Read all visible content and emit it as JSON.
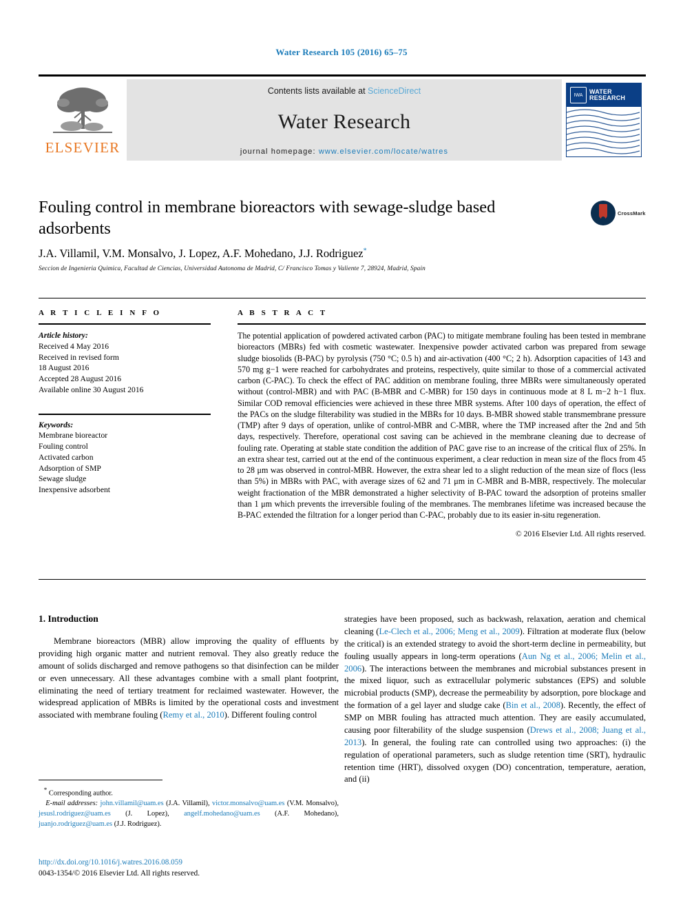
{
  "running_head": "Water Research 105 (2016) 65–75",
  "masthead": {
    "publisher_logo_text": "ELSEVIER",
    "contents_prefix": "Contents lists available at",
    "contents_link": "ScienceDirect",
    "journal_name": "Water Research",
    "homepage_prefix": "journal homepage:",
    "homepage_url": "www.elsevier.com/locate/watres",
    "cover_badge": "IWA",
    "cover_title_line1": "WATER",
    "cover_title_line2": "RESEARCH"
  },
  "article": {
    "title": "Fouling control in membrane bioreactors with sewage-sludge based adsorbents",
    "crossmark_label": "CrossMark",
    "authors": "J.A. Villamil, V.M. Monsalvo, J. Lopez, A.F. Mohedano, J.J. Rodriguez",
    "corresponding_marker": "*",
    "affiliation": "Seccion de Ingenieria Quimica, Facultad de Ciencias, Universidad Autonoma de Madrid, C/ Francisco Tomas y Valiente 7, 28924, Madrid, Spain"
  },
  "article_info": {
    "heading": "A R T I C L E   I N F O",
    "history_label": "Article history:",
    "history": [
      "Received 4 May 2016",
      "Received in revised form",
      "18 August 2016",
      "Accepted 28 August 2016",
      "Available online 30 August 2016"
    ],
    "keywords_label": "Keywords:",
    "keywords": [
      "Membrane bioreactor",
      "Fouling control",
      "Activated carbon",
      "Adsorption of SMP",
      "Sewage sludge",
      "Inexpensive adsorbent"
    ]
  },
  "abstract": {
    "heading": "A B S T R A C T",
    "text": "The potential application of powdered activated carbon (PAC) to mitigate membrane fouling has been tested in membrane bioreactors (MBRs) fed with cosmetic wastewater. Inexpensive powder activated carbon was prepared from sewage sludge biosolids (B-PAC) by pyrolysis (750 °C; 0.5 h) and air-activation (400 °C; 2 h). Adsorption capacities of 143 and 570 mg g−1 were reached for carbohydrates and proteins, respectively, quite similar to those of a commercial activated carbon (C-PAC). To check the effect of PAC addition on membrane fouling, three MBRs were simultaneously operated without (control-MBR) and with PAC (B-MBR and C-MBR) for 150 days in continuous mode at 8 L m−2 h−1 flux. Similar COD removal efficiencies were achieved in these three MBR systems. After 100 days of operation, the effect of the PACs on the sludge filterability was studied in the MBRs for 10 days. B-MBR showed stable transmembrane pressure (TMP) after 9 days of operation, unlike of control-MBR and C-MBR, where the TMP increased after the 2nd and 5th days, respectively. Therefore, operational cost saving can be achieved in the membrane cleaning due to decrease of fouling rate. Operating at stable state condition the addition of PAC gave rise to an increase of the critical flux of 25%. In an extra shear test, carried out at the end of the continuous experiment, a clear reduction in mean size of the flocs from 45 to 28 μm was observed in control-MBR. However, the extra shear led to a slight reduction of the mean size of flocs (less than 5%) in MBRs with PAC, with average sizes of 62 and 71 μm in C-MBR and B-MBR, respectively. The molecular weight fractionation of the MBR demonstrated a higher selectivity of B-PAC toward the adsorption of proteins smaller than 1 μm which prevents the irreversible fouling of the membranes. The membranes lifetime was increased because the B-PAC extended the filtration for a longer period than C-PAC, probably due to its easier in-situ regeneration.",
    "copyright": "© 2016 Elsevier Ltd. All rights reserved."
  },
  "introduction": {
    "heading": "1. Introduction",
    "left_para_1": "Membrane bioreactors (MBR) allow improving the quality of effluents by providing high organic matter and nutrient removal. They also greatly reduce the amount of solids discharged and remove pathogens so that disinfection can be milder or even unnecessary. All these advantages combine with a small plant footprint, eliminating the need of tertiary treatment for reclaimed wastewater. However, the widespread application of MBRs is limited by the operational costs and investment associated with membrane fouling (",
    "left_ref_1": "Remy et al., 2010",
    "left_para_1_end": "). Different fouling control",
    "right_para_start": "strategies have been proposed, such as backwash, relaxation, aeration and chemical cleaning (",
    "right_ref_1": "Le-Clech et al., 2006; Meng et al., 2009",
    "right_seg_2": "). Filtration at moderate flux (below the critical) is an extended strategy to avoid the short-term decline in permeability, but fouling usually appears in long-term operations (",
    "right_ref_2": "Aun Ng et al., 2006; Melin et al., 2006",
    "right_seg_3": "). The interactions between the membranes and microbial substances present in the mixed liquor, such as extracellular polymeric substances (EPS) and soluble microbial products (SMP), decrease the permeability by adsorption, pore blockage and the formation of a gel layer and sludge cake (",
    "right_ref_3": "Bin et al., 2008",
    "right_seg_4": "). Recently, the effect of SMP on MBR fouling has attracted much attention. They are easily accumulated, causing poor filterability of the sludge suspension (",
    "right_ref_4": "Drews et al., 2008; Juang et al., 2013",
    "right_seg_5": "). In general, the fouling rate can controlled using two approaches: (i) the regulation of operational parameters, such as sludge retention time (SRT), hydraulic retention time (HRT), dissolved oxygen (DO) concentration, temperature, aeration, and (ii)"
  },
  "footnotes": {
    "corresponding": "Corresponding author.",
    "email_label": "E-mail addresses:",
    "emails": [
      {
        "address": "john.villamil@uam.es",
        "name": "(J.A. Villamil)"
      },
      {
        "address": "victor.monsalvo@uam.es",
        "name": "(V.M. Monsalvo)"
      },
      {
        "address": "jesusl.rodriguez@uam.es",
        "name": "(J. Lopez)"
      },
      {
        "address": "angelf.mohedano@uam.es",
        "name": "(A.F. Mohedano)"
      },
      {
        "address": "juanjo.rodriguez@uam.es",
        "name": "(J.J. Rodriguez)"
      }
    ],
    "doi": "http://dx.doi.org/10.1016/j.watres.2016.08.059",
    "issn_line": "0043-1354/© 2016 Elsevier Ltd. All rights reserved."
  },
  "colors": {
    "link": "#1a7bb9",
    "elsevier_orange": "#e87722",
    "cover_blue": "#0b3f86",
    "masthead_gray": "#e3e3e3"
  }
}
